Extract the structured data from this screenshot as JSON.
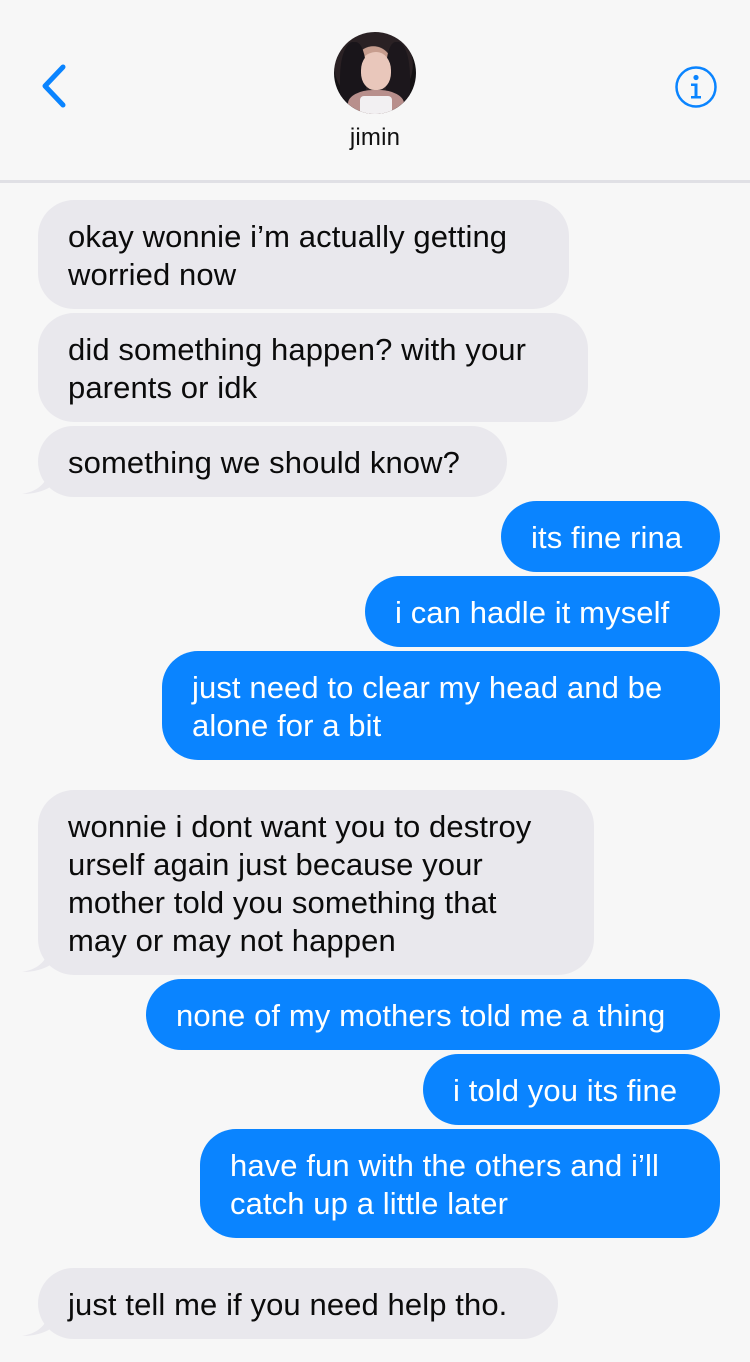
{
  "header": {
    "contact_name": "jimin"
  },
  "icons": {
    "back": "chevron-left-icon",
    "info": "info-icon"
  },
  "colors": {
    "incoming_bubble": "#e9e8ed",
    "outgoing_bubble": "#0a84ff",
    "accent": "#0a84ff"
  },
  "messages": [
    {
      "from": "them",
      "text": "okay wonnie i’m actually getting worried now"
    },
    {
      "from": "them",
      "text": "did something happen? with your parents or idk"
    },
    {
      "from": "them",
      "text": "something we should know?"
    },
    {
      "from": "me",
      "text": "its fine rina"
    },
    {
      "from": "me",
      "text": "i can hadle it myself"
    },
    {
      "from": "me",
      "text": "just need to clear my head and be alone for a bit"
    },
    {
      "from": "them",
      "text": "wonnie i dont want you to destroy urself again just because your mother told you something that may or may not happen"
    },
    {
      "from": "me",
      "text": "none of my mothers told me a thing"
    },
    {
      "from": "me",
      "text": "i told you its fine"
    },
    {
      "from": "me",
      "text": "have fun with the others and i’ll catch up a little later"
    },
    {
      "from": "them",
      "text": "just tell me if you need help tho."
    }
  ]
}
